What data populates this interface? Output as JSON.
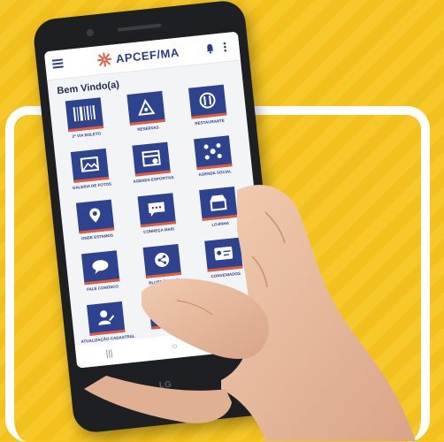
{
  "app": {
    "logo_text": "APCEF/MA",
    "welcome": "Bem Vindo(a)",
    "device_brand": "LG"
  },
  "tiles": [
    {
      "label": "2ª VIA BOLETO",
      "icon": "barcode-icon"
    },
    {
      "label": "RESERVAS",
      "icon": "reservation-icon"
    },
    {
      "label": "RESTAURANTE",
      "icon": "restaurant-icon"
    },
    {
      "label": "GALERIA DE FOTOS",
      "icon": "gallery-icon"
    },
    {
      "label": "AGENDA ESPORTIVA",
      "icon": "calendar-icon"
    },
    {
      "label": "AGENDA SOCIAL",
      "icon": "social-icon"
    },
    {
      "label": "ONDE ESTAMOS",
      "icon": "map-icon"
    },
    {
      "label": "CONHEÇA MAIS",
      "icon": "chat-icon"
    },
    {
      "label": "LOJINHA",
      "icon": "shop-icon"
    },
    {
      "label": "FALE CONOSCO",
      "icon": "message-icon"
    },
    {
      "label": "BLUES SOCIAIS",
      "icon": "share-icon"
    },
    {
      "label": "CONVENIADOS",
      "icon": "card-icon"
    },
    {
      "label": "ATUALIZAÇÃO CADASTRAL",
      "icon": "user-edit-icon"
    },
    {
      "label": "",
      "icon": "tag-icon"
    }
  ],
  "colors": {
    "background": "#f7c51e",
    "brand_blue": "#2d4390",
    "accent_red": "#e45a3a"
  }
}
